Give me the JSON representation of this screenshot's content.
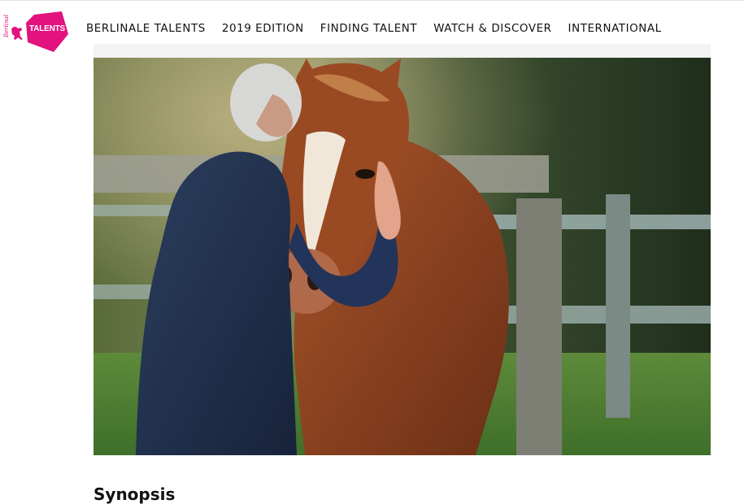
{
  "logo": {
    "label": "TALENTS",
    "vertical_text": "Berlinale",
    "brand_color": "#e2137e"
  },
  "nav": {
    "items": [
      {
        "label": "BERLINALE TALENTS"
      },
      {
        "label": "2019 EDITION"
      },
      {
        "label": "FINDING TALENT"
      },
      {
        "label": "WATCH & DISCOVER"
      },
      {
        "label": "INTERNATIONAL"
      }
    ]
  },
  "hero": {
    "description_icon": "photo-man-hugging-horse"
  },
  "content": {
    "heading_partial": "Synopsis"
  }
}
